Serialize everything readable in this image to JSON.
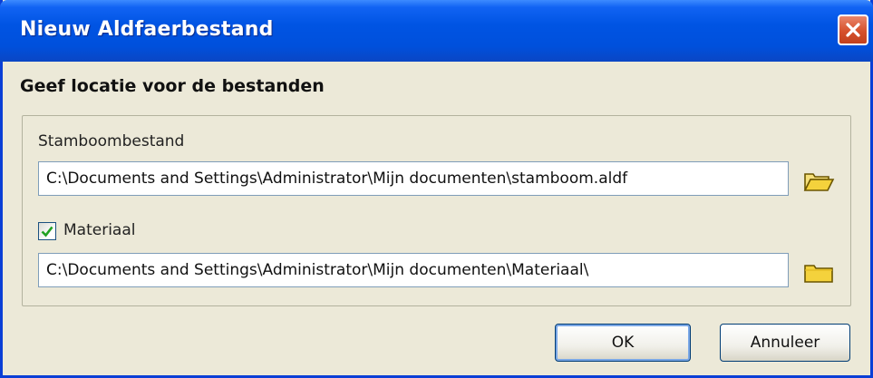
{
  "window": {
    "title": "Nieuw Aldfaerbestand",
    "close_icon": "close-icon"
  },
  "heading": "Geef locatie voor de bestanden",
  "stamboom": {
    "label": "Stamboombestand",
    "value": "C:\\Documents and Settings\\Administrator\\Mijn documenten\\stamboom.aldf",
    "browse_icon": "open-folder-icon"
  },
  "materiaal": {
    "label": "Materiaal",
    "checked": true,
    "value": "C:\\Documents and Settings\\Administrator\\Mijn documenten\\Materiaal\\",
    "browse_icon": "folder-icon"
  },
  "buttons": {
    "ok": "OK",
    "cancel": "Annuleer"
  },
  "colors": {
    "title_bar": "#0054e3",
    "dialog_bg": "#ece9d8",
    "close_button": "#d6512c",
    "folder": "#f4d23c",
    "checkmark": "#21a121"
  }
}
